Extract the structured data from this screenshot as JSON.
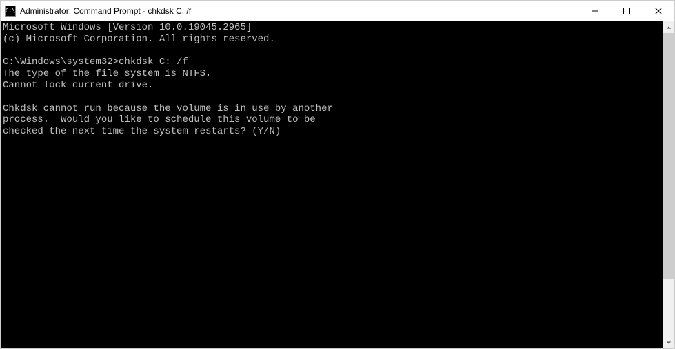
{
  "titlebar": {
    "icon_text": "C:\\",
    "title": "Administrator: Command Prompt - chkdsk  C: /f"
  },
  "terminal": {
    "line1": "Microsoft Windows [Version 10.0.19045.2965]",
    "line2": "(c) Microsoft Corporation. All rights reserved.",
    "blank1": "",
    "prompt": "C:\\Windows\\system32>",
    "command": "chkdsk C: /f",
    "line3": "The type of the file system is NTFS.",
    "line4": "Cannot lock current drive.",
    "blank2": "",
    "line5": "Chkdsk cannot run because the volume is in use by another",
    "line6": "process.  Would you like to schedule this volume to be",
    "line7": "checked the next time the system restarts? (Y/N)"
  }
}
